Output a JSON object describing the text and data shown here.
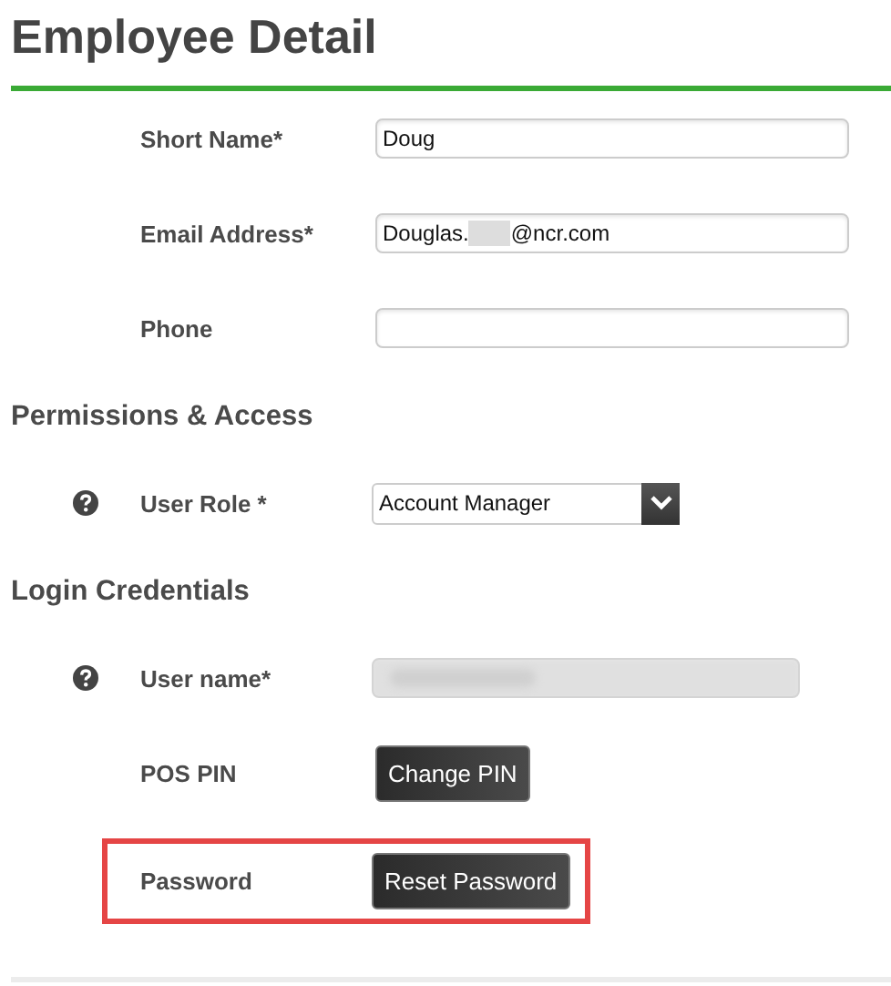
{
  "title": "Employee Detail",
  "sections": [
    {
      "rows": [
        {
          "label": "Short Name*",
          "kind": "text",
          "help": false,
          "highlighted": false,
          "value": "Doug"
        },
        {
          "label": "Email Address*",
          "kind": "redacted-text",
          "help": false,
          "highlighted": false,
          "value_start": "Douglas.",
          "value_end": "@ncr.com"
        },
        {
          "label": "Phone",
          "kind": "text",
          "help": false,
          "highlighted": false,
          "value": ""
        }
      ]
    },
    {
      "heading": "Permissions & Access",
      "rows": [
        {
          "label": "User Role *",
          "kind": "select",
          "help": true,
          "highlighted": false,
          "value": "Account Manager"
        }
      ]
    },
    {
      "heading": "Login Credentials",
      "rows": [
        {
          "label": "User name*",
          "kind": "blurred",
          "help": true,
          "highlighted": false
        },
        {
          "label": "POS PIN",
          "kind": "button",
          "help": false,
          "highlighted": false,
          "button": "Change PIN"
        },
        {
          "label": "Password",
          "kind": "button",
          "help": false,
          "highlighted": true,
          "button": "Reset Password"
        }
      ]
    }
  ]
}
